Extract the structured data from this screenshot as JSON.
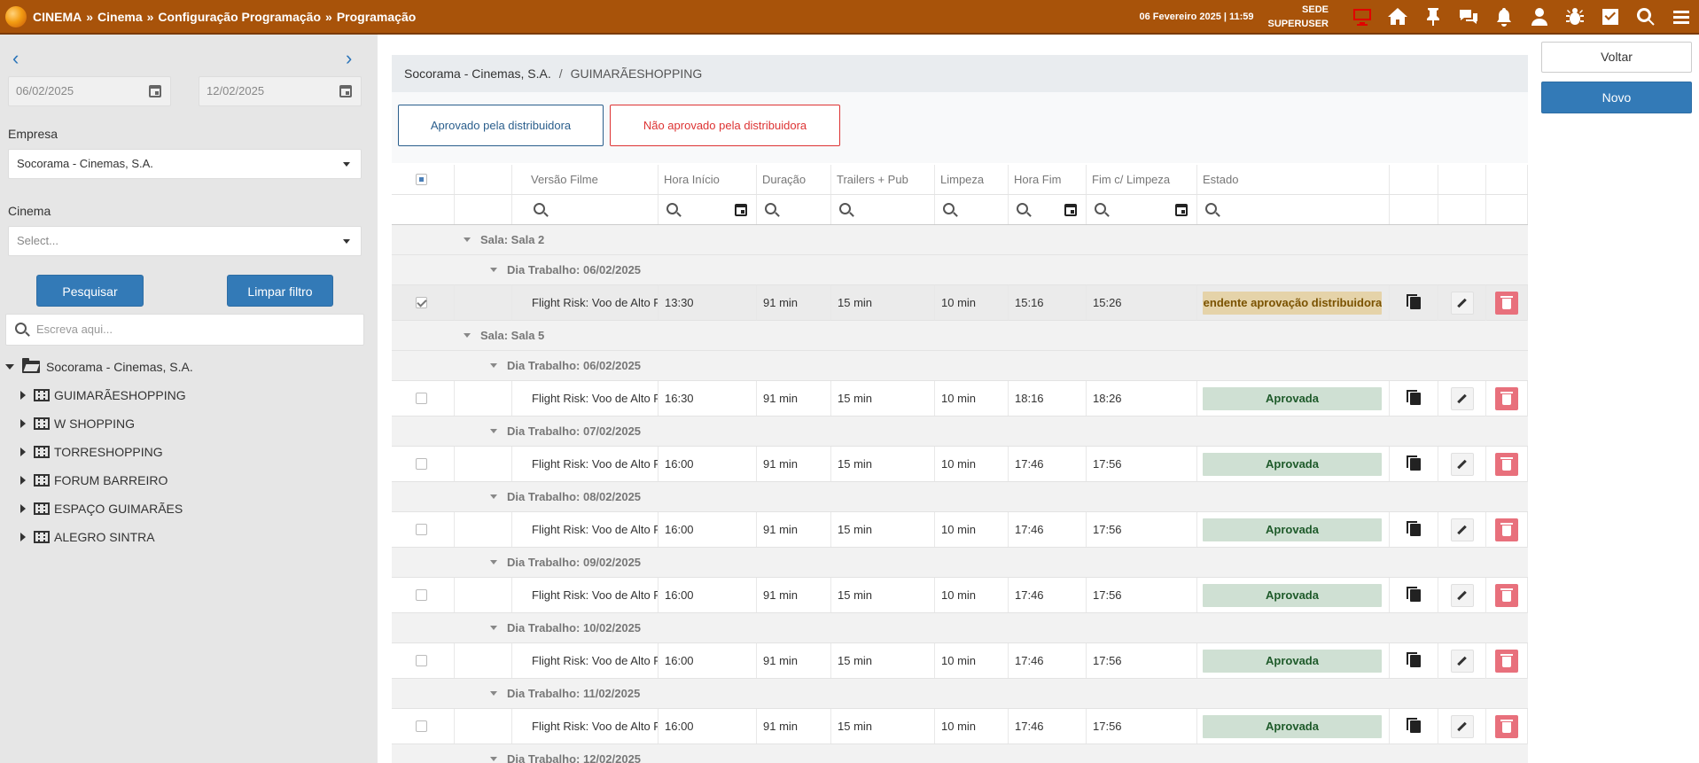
{
  "header": {
    "breadcrumb": [
      "CINEMA",
      "»",
      "Cinema",
      "»",
      "Configuração Programação",
      "»",
      "Programação"
    ],
    "datetime": "06 Fevereiro 2025 | 11:59",
    "location": "SEDE",
    "user": "SUPERUSER"
  },
  "sidebar": {
    "date_from": "06/02/2025",
    "date_to": "12/02/2025",
    "empresa_label": "Empresa",
    "empresa_value": "Socorama - Cinemas, S.A.",
    "cinema_label": "Cinema",
    "cinema_placeholder": "Select...",
    "search_button": "Pesquisar",
    "clear_button": "Limpar filtro",
    "tree_search_placeholder": "Escreva aqui...",
    "tree_root": "Socorama - Cinemas, S.A.",
    "tree_children": [
      "GUIMARÃESHOPPING",
      "W SHOPPING",
      "TORRESHOPPING",
      "FORUM BARREIRO",
      "ESPAÇO GUIMARÃES",
      "ALEGRO SINTRA"
    ]
  },
  "main": {
    "breadcrumb_company": "Socorama - Cinemas, S.A.",
    "breadcrumb_sep": "/",
    "breadcrumb_cinema": "GUIMARÃESHOPPING",
    "filter_approved": "Aprovado pela distribuidora",
    "filter_not_approved": "Não aprovado pela distribuidora",
    "columns": [
      "Versão Filme",
      "Hora Início",
      "Duração",
      "Trailers + Pub",
      "Limpeza",
      "Hora Fim",
      "Fim c/ Limpeza",
      "Estado"
    ],
    "groups": {
      "sala2": "Sala: Sala 2",
      "sala5": "Sala: Sala 5",
      "d0602": "Dia Trabalho: 06/02/2025",
      "d0702": "Dia Trabalho: 07/02/2025",
      "d0802": "Dia Trabalho: 08/02/2025",
      "d0902": "Dia Trabalho: 09/02/2025",
      "d1002": "Dia Trabalho: 10/02/2025",
      "d1102": "Dia Trabalho: 11/02/2025",
      "d1202": "Dia Trabalho: 12/02/2025"
    },
    "rows": [
      {
        "film": "Flight Risk: Voo de Alto Risco",
        "start": "13:30",
        "duration": "91 min",
        "trailers": "15 min",
        "cleaning": "10 min",
        "end": "15:16",
        "end_clean": "15:26",
        "status": "Pendente aprovação distribuidora"
      },
      {
        "film": "Flight Risk: Voo de Alto Risco",
        "start": "16:30",
        "duration": "91 min",
        "trailers": "15 min",
        "cleaning": "10 min",
        "end": "18:16",
        "end_clean": "18:26",
        "status": "Aprovada"
      },
      {
        "film": "Flight Risk: Voo de Alto Risco",
        "start": "16:00",
        "duration": "91 min",
        "trailers": "15 min",
        "cleaning": "10 min",
        "end": "17:46",
        "end_clean": "17:56",
        "status": "Aprovada"
      },
      {
        "film": "Flight Risk: Voo de Alto Risco",
        "start": "16:00",
        "duration": "91 min",
        "trailers": "15 min",
        "cleaning": "10 min",
        "end": "17:46",
        "end_clean": "17:56",
        "status": "Aprovada"
      },
      {
        "film": "Flight Risk: Voo de Alto Risco",
        "start": "16:00",
        "duration": "91 min",
        "trailers": "15 min",
        "cleaning": "10 min",
        "end": "17:46",
        "end_clean": "17:56",
        "status": "Aprovada"
      },
      {
        "film": "Flight Risk: Voo de Alto Risco",
        "start": "16:00",
        "duration": "91 min",
        "trailers": "15 min",
        "cleaning": "10 min",
        "end": "17:46",
        "end_clean": "17:56",
        "status": "Aprovada"
      },
      {
        "film": "Flight Risk: Voo de Alto Risco",
        "start": "16:00",
        "duration": "91 min",
        "trailers": "15 min",
        "cleaning": "10 min",
        "end": "17:46",
        "end_clean": "17:56",
        "status": "Aprovada"
      }
    ]
  },
  "right": {
    "back_button": "Voltar",
    "new_button": "Novo"
  },
  "colors": {
    "topbar": "#a8530a",
    "primary": "#337ab7",
    "approved_bg": "#cfe0d3",
    "pending_bg": "#e5d3a9",
    "delete": "#e8707c",
    "alert_icon": "#e00000"
  },
  "icons": [
    "desktop-icon",
    "home-icon",
    "pin-icon",
    "chat-icon",
    "bell-icon",
    "user-icon",
    "bug-icon",
    "checkbox-icon",
    "search-icon",
    "menu-icon",
    "calendar-icon",
    "copy-icon",
    "pencil-icon",
    "trash-icon",
    "folder-open-icon",
    "film-icon",
    "chevron-left-icon",
    "chevron-right-icon"
  ]
}
